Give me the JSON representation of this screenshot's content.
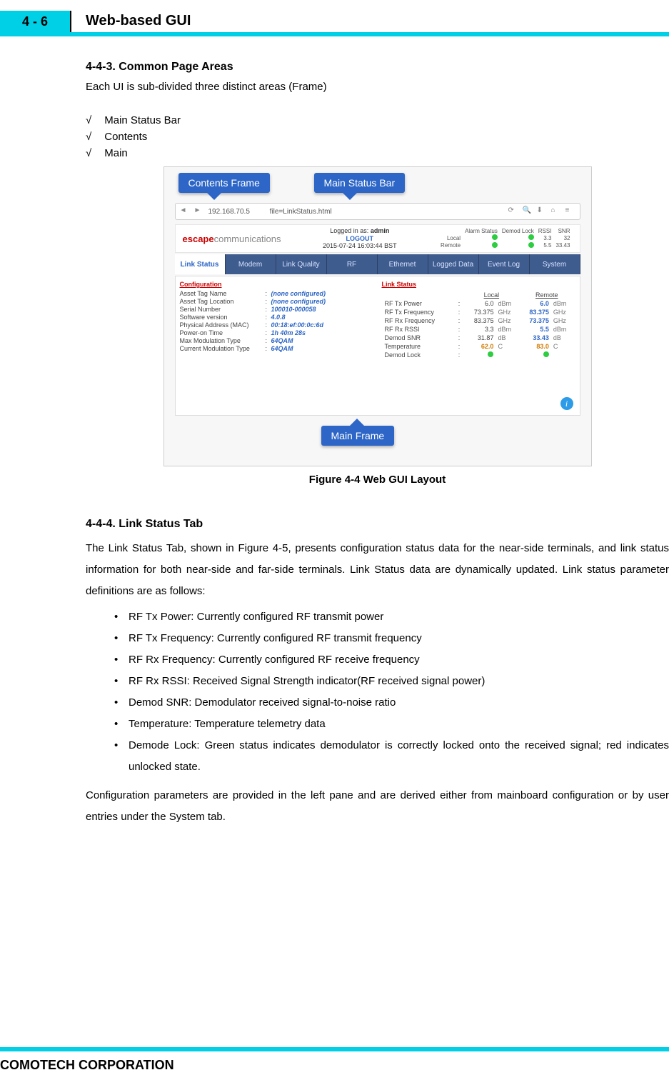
{
  "header": {
    "tab": "4 - 6",
    "title": "Web-based GUI"
  },
  "sec443": {
    "heading": "4-4-3. Common Page Areas",
    "intro": "Each UI is sub-divided three distinct areas (Frame)",
    "items": [
      "Main Status Bar",
      "Contents",
      "Main"
    ]
  },
  "figure": {
    "caption": "Figure 4-4 Web GUI Layout",
    "callouts": {
      "contents": "Contents Frame",
      "statusbar": "Main Status Bar",
      "mainframe": "Main Frame"
    },
    "browser": {
      "url": "192.168.70.5          file=LinkStatus.html",
      "reload_label": "C"
    },
    "brand": {
      "escape": "escape",
      "comm": "communications"
    },
    "login": {
      "logged_in_as": "Logged in as:",
      "user": "admin",
      "logout": "LOGOUT",
      "datetime": "2015-07-24 16:03:44 BST"
    },
    "mini_status": {
      "cols": [
        "Alarm Status",
        "Demod Lock",
        "RSSI",
        "SNR"
      ],
      "rows": [
        {
          "label": "Local",
          "alarm": "●",
          "lock": "●",
          "rssi": "3.3",
          "snr": "32"
        },
        {
          "label": "Remote",
          "alarm": "●",
          "lock": "●",
          "rssi": "5.5",
          "snr": "33.43"
        }
      ]
    },
    "tabs": [
      "Link Status",
      "Modem",
      "Link Quality",
      "RF",
      "Ethernet",
      "Logged Data",
      "Event Log",
      "System"
    ],
    "config_pane": {
      "title": "Configuration",
      "rows": [
        {
          "k": "Asset Tag Name",
          "v": "(none configured)"
        },
        {
          "k": "Asset Tag Location",
          "v": "(none configured)"
        },
        {
          "k": "Serial Number",
          "v": "100010-000058"
        },
        {
          "k": "Software version",
          "v": "4.0.8"
        },
        {
          "k": "Physical Address (MAC)",
          "v": "00:18:ef:00:0c:6d"
        },
        {
          "k": "Power-on Time",
          "v": "1h 40m 28s"
        },
        {
          "k": "Max Modulation Type",
          "v": "64QAM"
        },
        {
          "k": "Current Modulation Type",
          "v": "64QAM"
        }
      ]
    },
    "linkstatus_pane": {
      "title": "Link Status",
      "head_local": "Local",
      "head_remote": "Remote",
      "rows": [
        {
          "k": "RF Tx Power",
          "loc": "6.0",
          "lu": "dBm",
          "rem": "6.0",
          "ru": "dBm"
        },
        {
          "k": "RF Tx Frequency",
          "loc": "73.375",
          "lu": "GHz",
          "rem": "83.375",
          "ru": "GHz"
        },
        {
          "k": "RF Rx Frequency",
          "loc": "83.375",
          "lu": "GHz",
          "rem": "73.375",
          "ru": "GHz"
        },
        {
          "k": "RF Rx RSSI",
          "loc": "3.3",
          "lu": "dBm",
          "rem": "5.5",
          "ru": "dBm"
        },
        {
          "k": "Demod SNR",
          "loc": "31.87",
          "lu": "dB",
          "rem": "33.43",
          "ru": "dB"
        },
        {
          "k": "Temperature",
          "loc": "62.0",
          "lu": "C",
          "rem": "83.0",
          "ru": "C",
          "hot": true
        },
        {
          "k": "Demod Lock",
          "loc": "●",
          "lu": "",
          "rem": "●",
          "ru": "",
          "dot": true
        }
      ]
    }
  },
  "sec444": {
    "heading": "4-4-4. Link Status Tab",
    "p1": "The Link Status Tab, shown in Figure 4-5, presents configuration status data for the near-side terminals, and link status   information for both near-side and far-side terminals. Link Status data are dynamically updated. Link status parameter definitions are as follows:",
    "bullets": [
      "RF Tx Power: Currently configured RF transmit power",
      "RF Tx Frequency: Currently configured RF transmit frequency",
      "RF Rx Frequency: Currently configured RF receive frequency",
      "RF Rx RSSI: Received Signal Strength indicator(RF received signal power)",
      "Demod   SNR: Demodulator received signal-to-noise ratio",
      "Temperature: Temperature telemetry data",
      "Demode Lock: Green status indicates demodulator is correctly locked onto the received signal; red indicates unlocked state."
    ],
    "p2": "Configuration parameters are provided in the left pane and are derived either from mainboard configuration or by user entries under the System tab."
  },
  "footer": {
    "company": "COMOTECH CORPORATION"
  }
}
